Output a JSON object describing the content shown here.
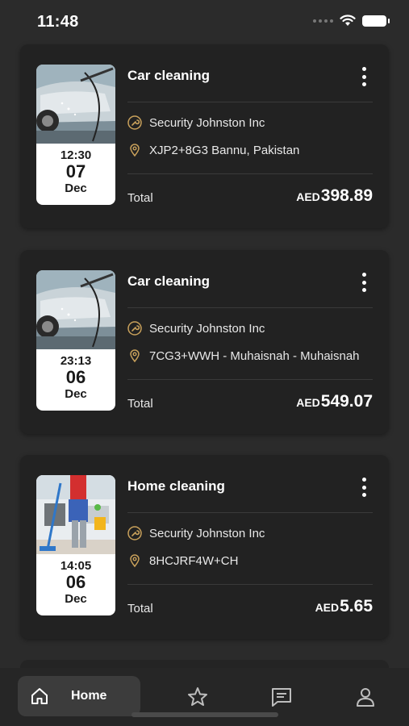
{
  "status_bar": {
    "time": "11:48"
  },
  "colors": {
    "accent_gold": "#c9a15b",
    "card_bg": "#222222",
    "page_bg": "#2b2b2b"
  },
  "bookings": [
    {
      "title": "Car cleaning",
      "image": "car-wash-image",
      "time": "12:30",
      "day": "07",
      "month": "Dec",
      "provider": "Security Johnston Inc",
      "location": "XJP2+8G3 Bannu, Pakistan",
      "total_label": "Total",
      "currency": "AED",
      "amount": "398.89"
    },
    {
      "title": "Car cleaning",
      "image": "car-wash-image",
      "time": "23:13",
      "day": "06",
      "month": "Dec",
      "provider": "Security Johnston Inc",
      "location": "7CG3+WWH - Muhaisnah - Muhaisnah",
      "total_label": "Total",
      "currency": "AED",
      "amount": "549.07"
    },
    {
      "title": "Home cleaning",
      "image": "home-cleaning-image",
      "time": "14:05",
      "day": "06",
      "month": "Dec",
      "provider": "Security Johnston Inc",
      "location": "8HCJRF4W+CH",
      "total_label": "Total",
      "currency": "AED",
      "amount": "5.65"
    }
  ],
  "nav": {
    "home_label": "Home",
    "items": [
      "home-icon",
      "star-icon",
      "chat-icon",
      "profile-icon"
    ]
  }
}
